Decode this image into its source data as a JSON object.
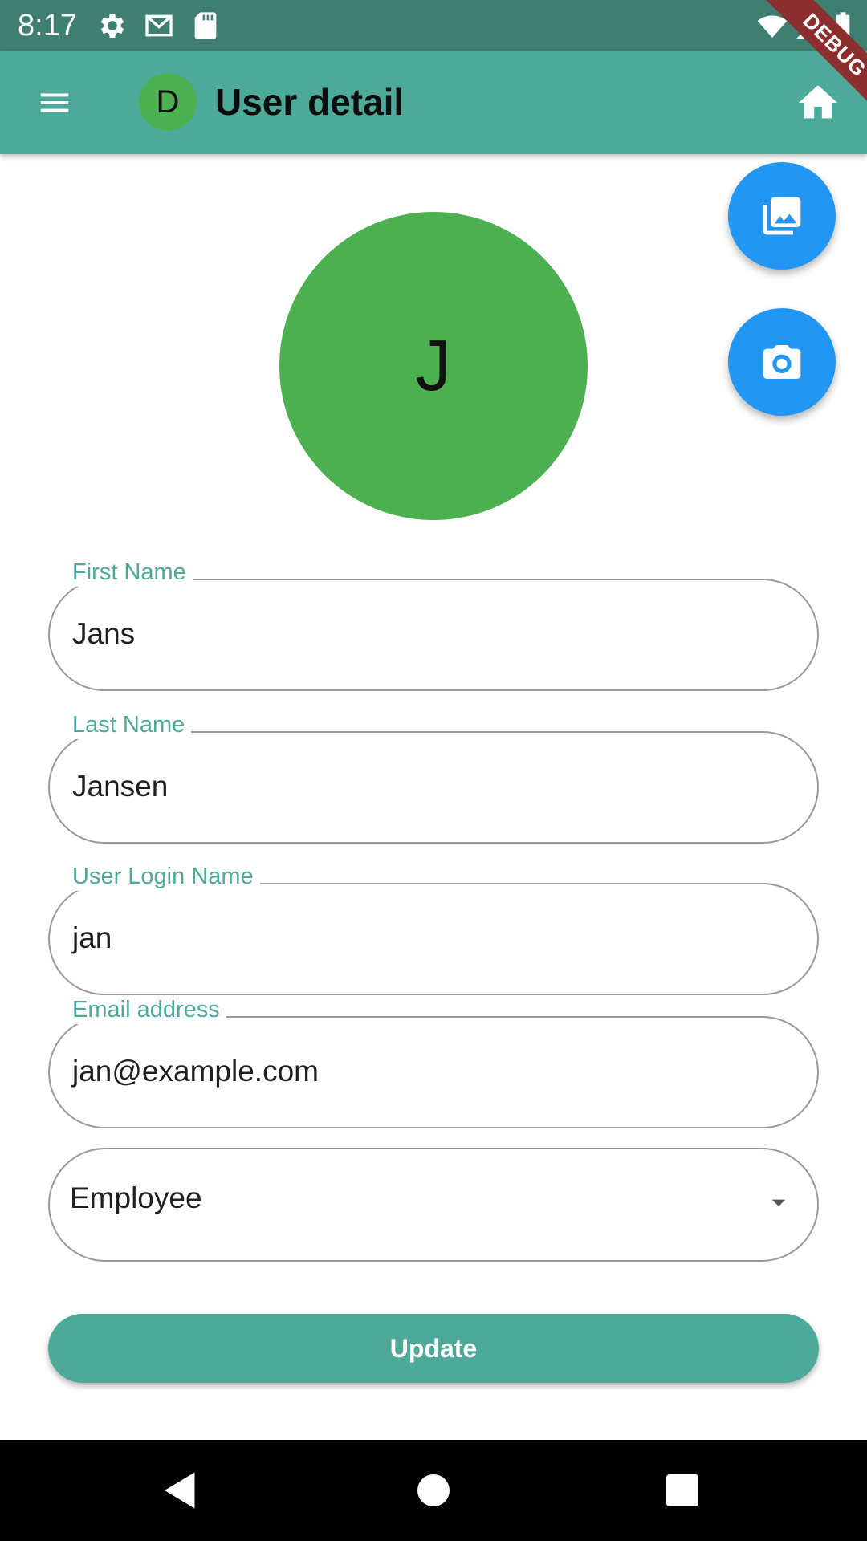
{
  "status_bar": {
    "time": "8:17",
    "icons": [
      "gear-icon",
      "gmail-icon",
      "sd-card-icon",
      "wifi-icon",
      "signal-icon",
      "battery-icon"
    ]
  },
  "app_bar": {
    "title": "User detail",
    "avatar_letter": "D",
    "debug_label": "DEBUG",
    "icons": [
      "menu-icon",
      "home-icon"
    ]
  },
  "profile": {
    "avatar_letter": "J",
    "fab_icons": [
      "photo-library-icon",
      "camera-icon"
    ]
  },
  "form": {
    "first_name": {
      "label": "First Name",
      "value": "Jans"
    },
    "last_name": {
      "label": "Last Name",
      "value": "Jansen"
    },
    "login_name": {
      "label": "User Login Name",
      "value": "jan"
    },
    "email": {
      "label": "Email address",
      "value": "jan@example.com"
    },
    "role": {
      "value": "Employee"
    },
    "update_label": "Update"
  },
  "nav_bar": {
    "icons": [
      "back-icon",
      "home-circle-icon",
      "recents-icon"
    ]
  },
  "colors": {
    "status_bar": "#3f7f72",
    "app_bar": "#4daa9a",
    "avatar_green": "#4caf50",
    "fab_blue": "#2196f3",
    "debug_ribbon": "#8c2e2e"
  }
}
